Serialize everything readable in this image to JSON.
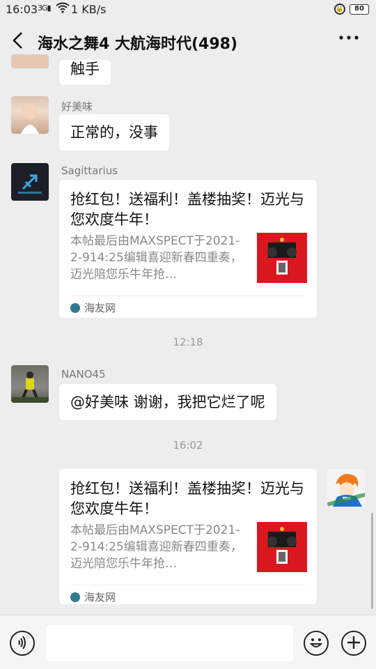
{
  "status_bar": {
    "time": "16:03",
    "signal": "3G",
    "wifi_icon": "wifi-icon",
    "rate": "1 KB/s",
    "battery": "80"
  },
  "header": {
    "title": "海水之舞4 大航海时代(498)",
    "back_icon": "back-arrow-icon",
    "more_icon": "more-icon"
  },
  "messages": {
    "partial_text": "触手",
    "m1": {
      "sender": "好美味",
      "text": "正常的，没事"
    },
    "m2": {
      "sender": "Sagittarius",
      "card": {
        "title": "抢红包！送福利！盖楼抽奖！迈光与您欢度牛年！",
        "desc": "本帖最后由MAXSPECT于2021-2-914:25编辑喜迎新春四重奏，迈光陪您乐牛年抢…",
        "source": "海友网"
      }
    },
    "ts1": "12:18",
    "m3": {
      "sender": "NANO45",
      "text": "@好美味  谢谢，我把它烂了呢"
    },
    "ts2": "16:02",
    "m4": {
      "card": {
        "title": "抢红包！送福利！盖楼抽奖！迈光与您欢度牛年！",
        "desc": "本帖最后由MAXSPECT于2021-2-914:25编辑喜迎新春四重奏，迈光陪您乐牛年抢…",
        "source": "海友网"
      }
    }
  },
  "input_bar": {
    "voice_icon": "voice-icon",
    "emoji_icon": "emoji-icon",
    "plus_icon": "plus-icon"
  },
  "colors": {
    "background": "#ededed",
    "bubble": "#ffffff",
    "muted_text": "#888888"
  }
}
